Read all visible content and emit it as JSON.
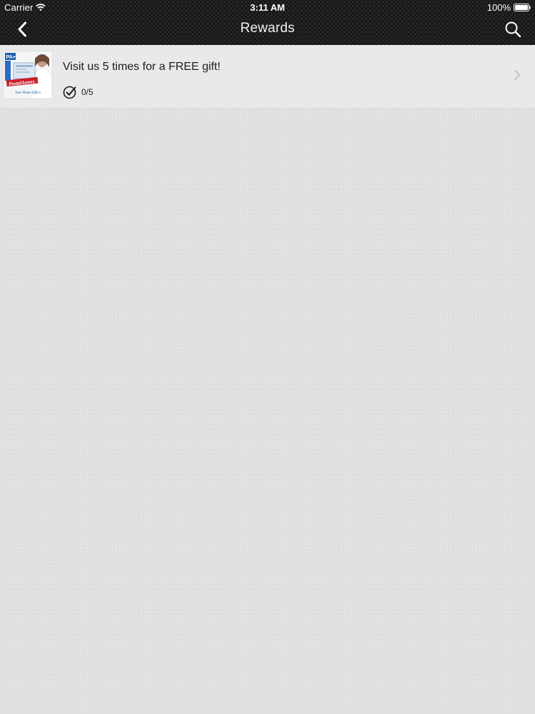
{
  "status_bar": {
    "carrier": "Carrier",
    "time": "3:11 AM",
    "battery": "100%",
    "icons": [
      "wifi-icon",
      "battery-icon"
    ]
  },
  "nav_bar": {
    "title": "Rewards",
    "back_icon": "back-chevron-icon",
    "search_icon": "search-icon",
    "background_color": "#151515"
  },
  "rewards": [
    {
      "title": "Visit us 5 times for a FREE gift!",
      "progress": "0/5",
      "progress_icon": "checkmark-circle-icon",
      "thumbnail_logo": "PostalAnnex",
      "thumbnail_badge": "PA+",
      "thumbnail_tagline": "Your Home Office"
    }
  ],
  "colors": {
    "page_background": "#e0e0e1",
    "row_background": "#e9e9ea",
    "logo_red": "#c8202b",
    "logo_blue": "#1f5fa8"
  }
}
